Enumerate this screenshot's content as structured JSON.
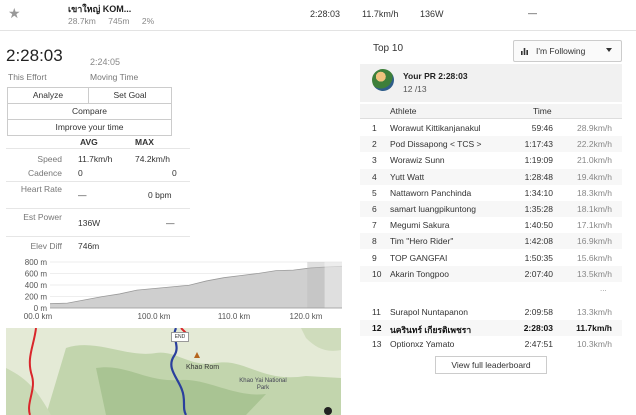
{
  "topbar": {
    "segment_name": "เขาใหญ่ KOM...",
    "distance": "28.7km",
    "elevation": "745m",
    "grade": "2%",
    "time": "2:28:03",
    "speed": "11.7km/h",
    "power": "136W",
    "dash": "—"
  },
  "effort": {
    "time": "2:28:03",
    "moving_time": "2:24:05",
    "time_label": "This Effort",
    "moving_label": "Moving Time"
  },
  "buttons": {
    "analyze": "Analyze",
    "set_goal": "Set Goal",
    "compare": "Compare",
    "improve": "Improve your time"
  },
  "stats": {
    "avg_header": "AVG",
    "max_header": "MAX",
    "rows": [
      {
        "label": "Speed",
        "avg": "11.7km/h",
        "max": "74.2km/h"
      },
      {
        "label": "Cadence",
        "avg": "0",
        "max": "0"
      },
      {
        "label": "Heart Rate",
        "avg": "—",
        "max": "0 bpm"
      },
      {
        "label": "Est Power",
        "avg": "136W",
        "max": "—"
      },
      {
        "label": "Elev Diff",
        "avg": "746m",
        "max": ""
      }
    ]
  },
  "chart_data": {
    "type": "area",
    "title": "",
    "xlabel": "",
    "ylabel": "",
    "y_ticks": [
      "800 m",
      "600 m",
      "400 m",
      "200 m",
      "0 m"
    ],
    "x_ticks": [
      "00.0 km",
      "100.0 km",
      "110.0 km",
      "120.0 km"
    ],
    "x": [
      0,
      20,
      40,
      60,
      80,
      100,
      120,
      140,
      160,
      180,
      200,
      220,
      240,
      260,
      280,
      300,
      320,
      336
    ],
    "y": [
      80,
      90,
      150,
      210,
      260,
      330,
      360,
      390,
      420,
      500,
      560,
      600,
      640,
      690,
      700,
      740,
      760,
      770
    ],
    "ylim": [
      0,
      850
    ],
    "highlight": {
      "from": 296,
      "to": 316
    },
    "colors": {
      "fill": "#cfcfcf",
      "line": "#9a9a9a",
      "after": "#e6e6e6"
    }
  },
  "map": {
    "label_khao_rom": "Khao Rom",
    "label_park": "Khao Yai National Park",
    "pin_label": "END"
  },
  "leaderboard": {
    "title": "Top 10",
    "filter": "I'm Following",
    "pr_label": "Your PR 2:28:03",
    "pr_rank": "12 /13",
    "col_athlete": "Athlete",
    "col_time": "Time",
    "rows": [
      {
        "rank": "1",
        "athlete": "Worawut Kittikanjanakul",
        "time": "59:46",
        "speed": "28.9km/h"
      },
      {
        "rank": "2",
        "athlete": "Pod Dissapong < TCS >",
        "time": "1:17:43",
        "speed": "22.2km/h"
      },
      {
        "rank": "3",
        "athlete": "Worawiz Sunn",
        "time": "1:19:09",
        "speed": "21.0km/h"
      },
      {
        "rank": "4",
        "athlete": "Yutt Watt",
        "time": "1:28:48",
        "speed": "19.4km/h"
      },
      {
        "rank": "5",
        "athlete": "Nattaworn Panchinda",
        "time": "1:34:10",
        "speed": "18.3km/h"
      },
      {
        "rank": "6",
        "athlete": "samart luangpikuntong",
        "time": "1:35:28",
        "speed": "18.1km/h"
      },
      {
        "rank": "7",
        "athlete": "Megumi Sakura",
        "time": "1:40:50",
        "speed": "17.1km/h"
      },
      {
        "rank": "8",
        "athlete": "Tim \"Hero Rider\"",
        "time": "1:42:08",
        "speed": "16.9km/h"
      },
      {
        "rank": "9",
        "athlete": "TOP GANGFAI",
        "time": "1:50:35",
        "speed": "15.6km/h"
      },
      {
        "rank": "10",
        "athlete": "Akarin Tongpoo",
        "time": "2:07:40",
        "speed": "13.5km/h"
      }
    ],
    "rows_after": [
      {
        "rank": "11",
        "athlete": "Surapol Nuntapanon",
        "time": "2:09:58",
        "speed": "13.3km/h"
      },
      {
        "rank": "12",
        "athlete": "นครินทร์ เกียรติเพชรา",
        "time": "2:28:03",
        "speed": "11.7km/h"
      },
      {
        "rank": "13",
        "athlete": "Optionxz Yamato",
        "time": "2:47:51",
        "speed": "10.3km/h"
      }
    ],
    "ellipsis": "...",
    "view_all": "View full leaderboard"
  },
  "colors": {
    "route_red": "#d9262b",
    "route_blue": "#2a3f9d"
  }
}
